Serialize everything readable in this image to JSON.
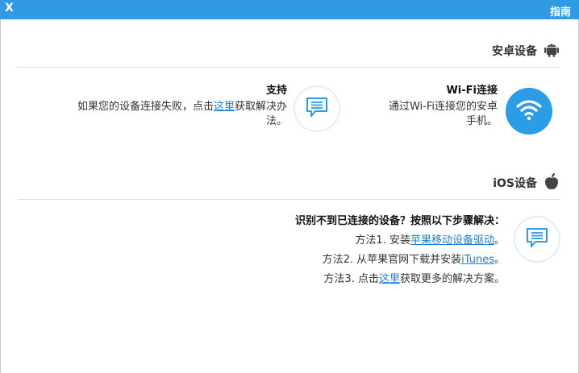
{
  "window": {
    "title": "指南",
    "close_label": "X"
  },
  "android": {
    "section_title": "安卓设备",
    "wifi": {
      "heading": "Wi-Fi连接",
      "line1": "通过Wi-Fi连接您的安卓",
      "line2": "手机。"
    },
    "support": {
      "heading": "支持",
      "line1_prefix": "如果您的设备连接失败，点击",
      "link": "这里",
      "line1_suffix": "获取解决办",
      "line2": "法。"
    }
  },
  "ios": {
    "section_title": "iOS设备",
    "heading": "识别不到已连接的设备？按照以下步骤解决：",
    "method1_prefix": "方法1. 安装",
    "method1_link": "苹果移动设备驱动",
    "method1_suffix": "。",
    "method2_prefix": "方法2. 从苹果官网下载并安装",
    "method2_link": "iTunes",
    "method2_suffix": "。",
    "method3_prefix": "方法3. 点击",
    "method3_link": "这里",
    "method3_suffix": "获取更多的解决方案。"
  },
  "colors": {
    "titlebar": "#2f9be4",
    "accent": "#2b9ce6",
    "link": "#1b7fd1"
  }
}
